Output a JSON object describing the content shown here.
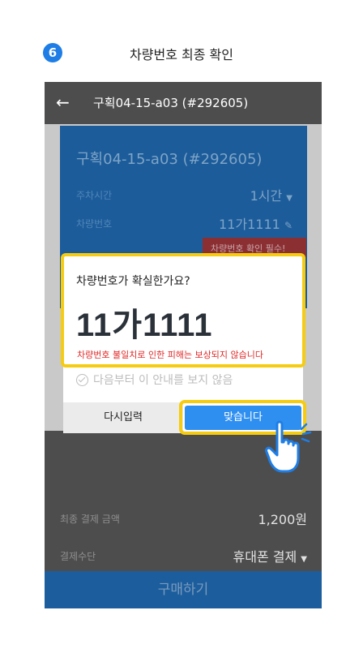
{
  "step": {
    "number": "6",
    "title": "차량번호 최종 확인"
  },
  "header": {
    "title": "구획04-15-a03 (#292605)"
  },
  "card": {
    "title": "구획04-15-a03 (#292605)",
    "parking_time_label": "주차시간",
    "parking_time_value": "1시간",
    "plate_label": "차량번호",
    "plate_value": "11가1111",
    "warning_chip": "차량번호 확인 필수!"
  },
  "dialog": {
    "question": "차량번호가 확실한가요?",
    "plate": "11가1111",
    "warning": "차량번호 불일치로 인한 피해는 보상되지 않습니다",
    "dont_show": "다음부터 이 안내를 보지 않음",
    "reenter_label": "다시입력",
    "confirm_label": "맞습니다"
  },
  "payment": {
    "total_label": "최종 결제 금액",
    "total_value": "1,200원",
    "method_label": "결제수단",
    "method_value": "휴대폰 결제"
  },
  "buy_label": "구매하기",
  "colors": {
    "accent": "#2f8ff0",
    "highlight": "#f5cc12",
    "warning": "#e02828"
  }
}
